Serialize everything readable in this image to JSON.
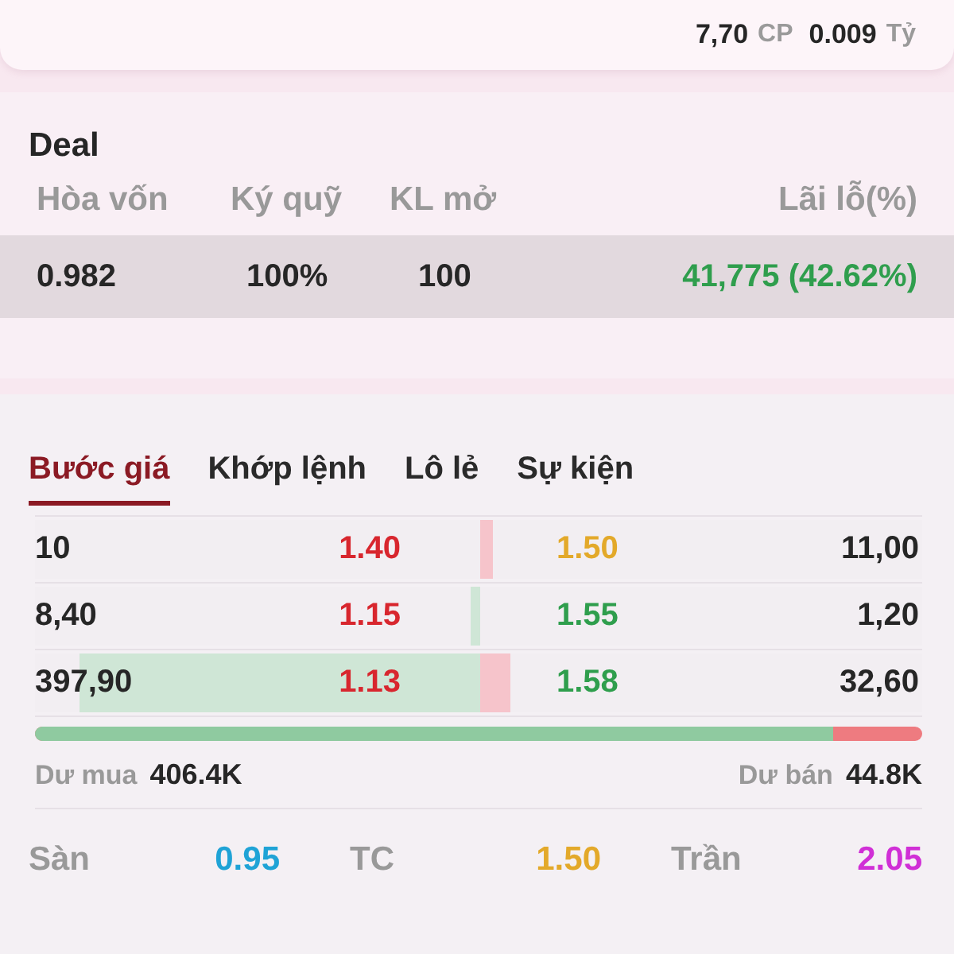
{
  "summary": {
    "volume": "7,70",
    "volume_unit": "CP",
    "value": "0.009",
    "value_unit": "Tỷ"
  },
  "deal": {
    "title": "Deal",
    "columns": [
      "Hòa vốn",
      "Ký quỹ",
      "KL mở",
      "Lãi lỗ(%)"
    ],
    "row": [
      "0.982",
      "100%",
      "100",
      "41,775 (42.62%)"
    ]
  },
  "tabs": [
    {
      "label": "Bước giá",
      "selected": true
    },
    {
      "label": "Khớp lệnh",
      "selected": false
    },
    {
      "label": "Lô lẻ",
      "selected": false
    },
    {
      "label": "Sự kiện",
      "selected": false
    }
  ],
  "order_book": [
    {
      "buy": {
        "volume": "10",
        "price": "1.40",
        "color": "#d8262e"
      },
      "sell": {
        "price": "1.50",
        "color": "#e3a92a",
        "level": 0.03,
        "volume": "11,00"
      }
    },
    {
      "buy": {
        "volume": "8,40",
        "price": "1.15",
        "color": "#d8262e",
        "level": 0.02
      },
      "sell": {
        "price": "1.55",
        "color": "#2f9e4d",
        "volume": "1,20"
      }
    },
    {
      "buy": {
        "volume": "397,90",
        "price": "1.13",
        "color": "#d8262e",
        "level": 0.9
      },
      "sell": {
        "price": "1.58",
        "color": "#2f9e4d",
        "level": 0.07,
        "volume": "32,60"
      }
    }
  ],
  "balance": {
    "level": 0.9,
    "buy_label": "Dư mua",
    "buy_value": "406.4K",
    "sell_label": "Dư bán",
    "sell_value": "44.8K"
  },
  "stats": [
    {
      "label": "Sàn",
      "value": "0.95",
      "color": "#1fa3d6"
    },
    {
      "label": "TC",
      "value": "1.50",
      "color": "#e3a92a"
    },
    {
      "label": "Trần",
      "value": "2.05",
      "color": "#d02fd6"
    }
  ]
}
